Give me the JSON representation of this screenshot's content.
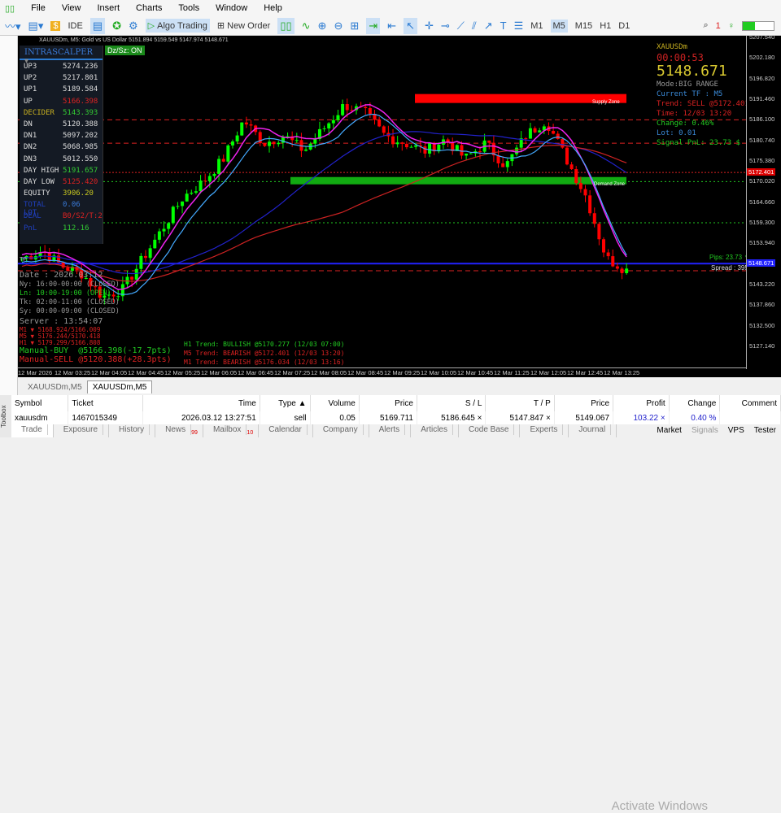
{
  "menu": [
    "File",
    "View",
    "Insert",
    "Charts",
    "Tools",
    "Window",
    "Help"
  ],
  "toolbar": {
    "ide": "IDE",
    "algo": "Algo Trading",
    "new_order": "New Order",
    "timeframes": [
      "M1",
      "M5",
      "M15",
      "H1",
      "D1"
    ],
    "active_tf": "M5",
    "notif": "1"
  },
  "chart": {
    "header": "XAUUSDm, M5: Gold vs US Dollar 5151.894 5159.549 5147.974 5148.671",
    "dz": "Dz/Sz: ON",
    "panel": {
      "title": "INTRASCALPER",
      "rows": [
        {
          "k": "UP3",
          "v": "5274.236",
          "kc": "#ddd",
          "vc": "#ddd"
        },
        {
          "k": "UP2",
          "v": "5217.801",
          "kc": "#ddd",
          "vc": "#ddd"
        },
        {
          "k": "UP1",
          "v": "5189.584",
          "kc": "#ddd",
          "vc": "#ddd"
        },
        {
          "k": "UP",
          "v": "5166.398",
          "kc": "#ddd",
          "vc": "#d22"
        },
        {
          "k": "DECIDER",
          "v": "5143.393",
          "kc": "#c8b020",
          "vc": "#3c3"
        },
        {
          "k": "DN",
          "v": "5120.388",
          "kc": "#ddd",
          "vc": "#ddd"
        },
        {
          "k": "DN1",
          "v": "5097.202",
          "kc": "#ddd",
          "vc": "#ddd"
        },
        {
          "k": "DN2",
          "v": "5068.985",
          "kc": "#ddd",
          "vc": "#ddd"
        },
        {
          "k": "DN3",
          "v": "5012.550",
          "kc": "#ddd",
          "vc": "#ddd"
        },
        {
          "k": "DAY HIGH",
          "v": "5191.657",
          "kc": "#ddd",
          "vc": "#3c3"
        },
        {
          "k": "DAY LOW",
          "v": "5125.420",
          "kc": "#ddd",
          "vc": "#d22"
        },
        {
          "k": "EQUITY",
          "v": "3906.20",
          "kc": "#ddd",
          "vc": "#c8c820"
        },
        {
          "k": "TOTAL LOT",
          "v": "0.06",
          "kc": "#2040c0",
          "vc": "#3a7ad8"
        },
        {
          "k": "DEAL",
          "v": "B0/S2/T:2",
          "kc": "#2040c0",
          "vc": "#d22"
        },
        {
          "k": "PnL",
          "v": "112.16",
          "kc": "#2040c0",
          "vc": "#3c3"
        }
      ]
    },
    "session": {
      "date": "Date : 2026.03.12",
      "ny": "Ny: 16:00-00:00 (CLOSED)",
      "ln": "Ln: 10:00-19:00 (OPEN)",
      "tk": "Tk: 02:00-11:00 (CLOSED)",
      "sy": "Sy: 00:00-09:00 (CLOSED)",
      "server": "Server : 13:54:07",
      "m1": "M1 ▼ 5168.924/5166.009",
      "m5": "M5 ▼ 5176.244/5170.418",
      "h1": "H1 ▼ 5179.299/5166.808",
      "buy": "Manual-BUY  @5166.398(-17.7pts)",
      "sell": "Manual-SELL @5120.388(+28.3pts)"
    },
    "trends": [
      "H1 Trend: BULLISH @5170.277 (12/03 07:00)",
      "M5 Trend: BEARISH @5172.401 (12/03 13:20)",
      "M1 Trend: BEARISH @5176.034 (12/03 13:16)"
    ],
    "right": {
      "symbol": "XAUUSDm",
      "timer": "00:00:53",
      "price": "5148.671",
      "mode": "Mode:BIG RANGE",
      "tf": "Current TF : M5",
      "trend": "Trend: SELL @5172.401",
      "time": "Time: 12/03 13:20",
      "change": "Change: 0.46%",
      "lot": "Lot: 0.01",
      "pnl": "Signal PnL: 23.73 $"
    },
    "supply": "Supply Zone",
    "demand": "Demand Zone",
    "pips": "Pips: 23.73 ▼",
    "spread": "Spread : 395",
    "tp": "TP",
    "price_tag_red": "5172.401",
    "price_tag_blue": "5148.671",
    "price_ticks": [
      "5207.540",
      "5202.180",
      "5196.820",
      "5191.460",
      "5186.100",
      "5180.740",
      "5175.380",
      "5170.020",
      "5164.660",
      "5159.300",
      "5153.940",
      "5148.580",
      "5143.220",
      "5137.860",
      "5132.500",
      "5127.140"
    ],
    "time_ticks": [
      "12 Mar 2026",
      "12 Mar 03:25",
      "12 Mar 04:05",
      "12 Mar 04:45",
      "12 Mar 05:25",
      "12 Mar 06:05",
      "12 Mar 06:45",
      "12 Mar 07:25",
      "12 Mar 08:05",
      "12 Mar 08:45",
      "12 Mar 09:25",
      "12 Mar 10:05",
      "12 Mar 10:45",
      "12 Mar 11:25",
      "12 Mar 12:05",
      "12 Mar 12:45",
      "12 Mar 13:25"
    ],
    "price_path": [
      5150,
      5152,
      5148,
      5146,
      5140,
      5142,
      5150,
      5158,
      5166,
      5170,
      5176,
      5186,
      5180,
      5182,
      5178,
      5184,
      5190,
      5188,
      5182,
      5180,
      5178,
      5181,
      5176,
      5180,
      5174,
      5182,
      5186,
      5176,
      5166,
      5150,
      5147
    ]
  },
  "tabs": [
    "XAUUSDm,M5",
    "XAUUSDm,M5"
  ],
  "table": {
    "headers": [
      "Symbol",
      "Ticket",
      "Time",
      "Type ▲",
      "Volume",
      "Price",
      "S / L",
      "T / P",
      "Price",
      "Profit",
      "Change",
      "Comment"
    ],
    "row": [
      "xauusdm",
      "1467015349",
      "2026.03.12 13:27:51",
      "sell",
      "0.05",
      "5169.711",
      "5186.645 ×",
      "5147.847 ×",
      "5149.067",
      "103.22 ×",
      "0.40 %",
      ""
    ]
  },
  "toolbox": "Toolbox",
  "bottom_tabs": [
    {
      "l": "Trade"
    },
    {
      "l": "Exposure"
    },
    {
      "l": "History"
    },
    {
      "l": "News",
      "b": "99"
    },
    {
      "l": "Mailbox",
      "b": "10"
    },
    {
      "l": "Calendar"
    },
    {
      "l": "Company"
    },
    {
      "l": "Alerts"
    },
    {
      "l": "Articles"
    },
    {
      "l": "Code Base"
    },
    {
      "l": "Experts"
    },
    {
      "l": "Journal"
    }
  ],
  "status": [
    "Market",
    "Signals",
    "VPS",
    "Tester"
  ],
  "watermark": "Activate Windows"
}
